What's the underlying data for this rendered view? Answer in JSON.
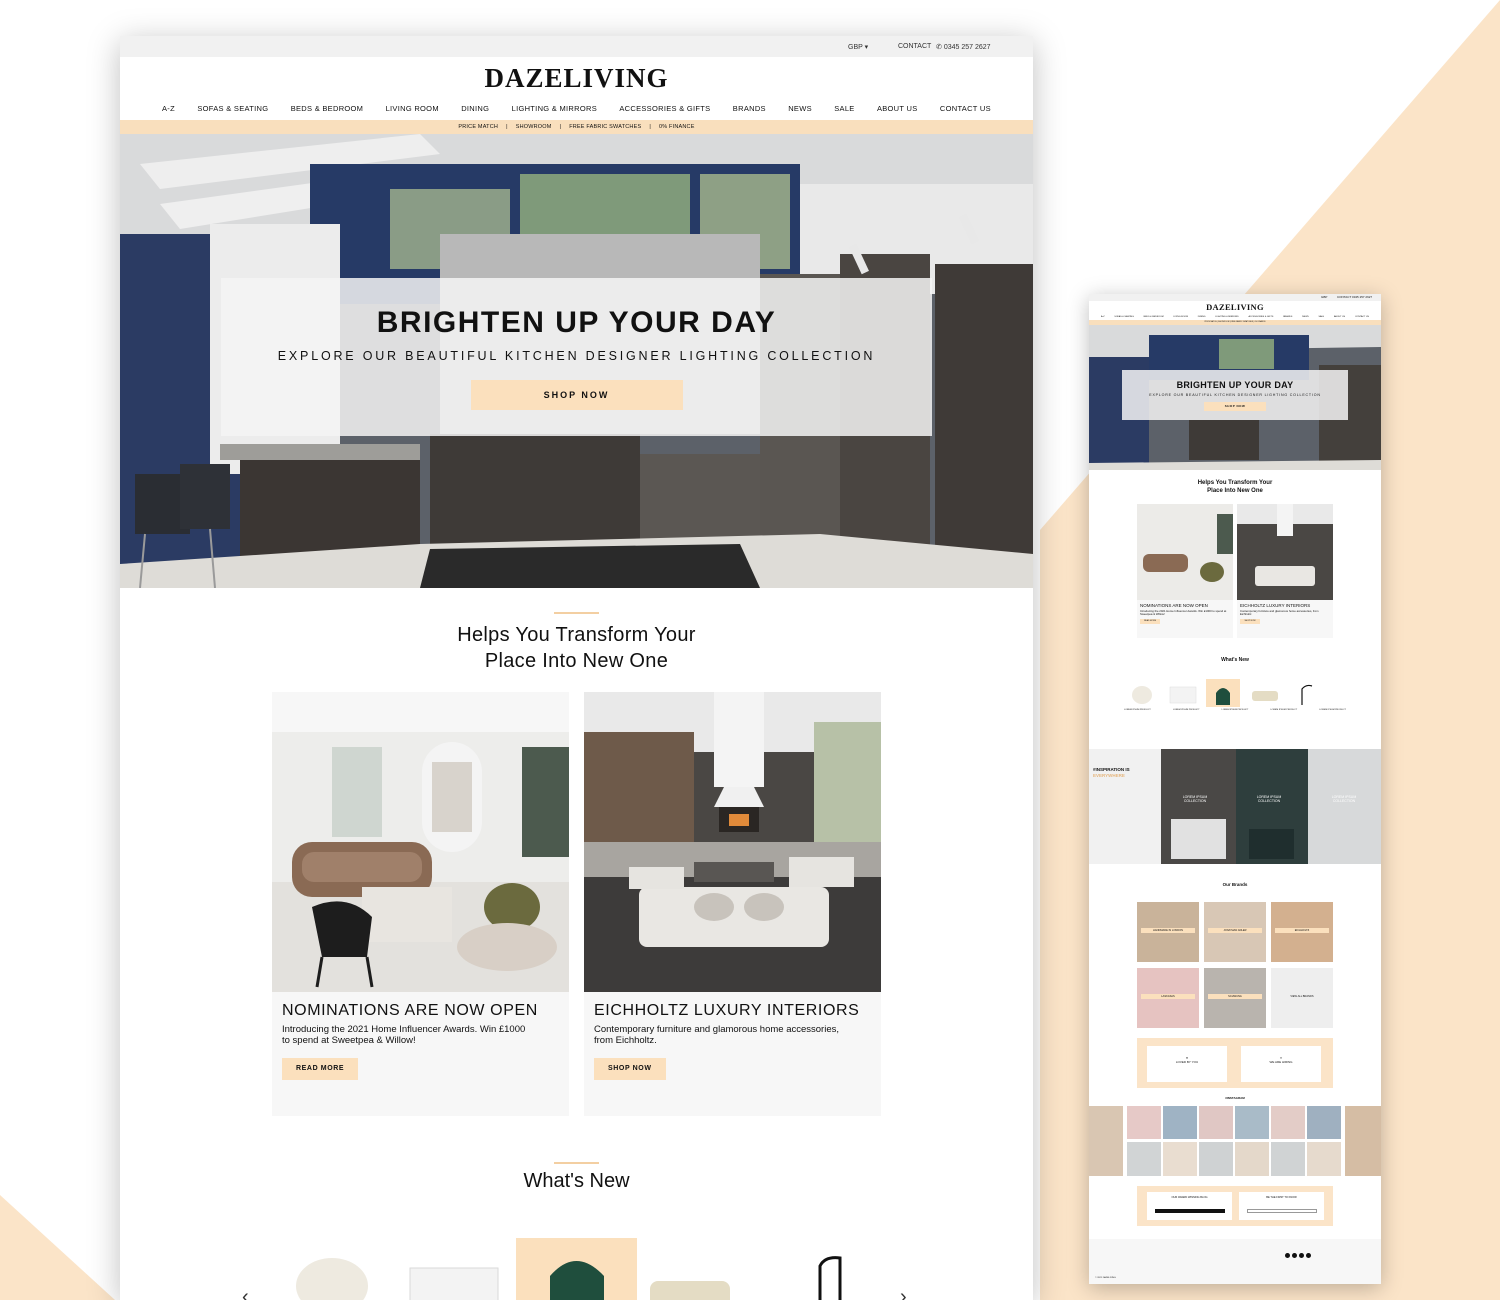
{
  "colors": {
    "peach": "#f9dfbd",
    "peach_bg": "#fbe4c8",
    "accent_rule": "#f3cfa2",
    "navy": "#2c3a5b",
    "light_gray": "#f1f1f1"
  },
  "desktop": {
    "topbar": {
      "currency": "GBP ▾",
      "contact": "CONTACT",
      "phone": "0345 257 2627"
    },
    "logo": "DAZELIVING",
    "nav": [
      "A-Z",
      "SOFAS & SEATING",
      "BEDS & BEDROOM",
      "LIVING ROOM",
      "DINING",
      "LIGHTING & MIRRORS",
      "ACCESSORIES & GIFTS",
      "BRANDS",
      "NEWS",
      "SALE",
      "ABOUT US",
      "CONTACT US"
    ],
    "promo": [
      "PRICE MATCH",
      "|",
      "SHOWROOM",
      "|",
      "FREE FABRIC SWATCHES",
      "|",
      "0% FINANCE"
    ],
    "hero": {
      "title": "BRIGHTEN UP YOUR DAY",
      "subtitle": "EXPLORE OUR BEAUTIFUL KITCHEN DESIGNER LIGHTING COLLECTION",
      "button": "SHOP NOW"
    },
    "section_title_line1": "Helps You Transform Your",
    "section_title_line2": "Place Into New One",
    "cards": [
      {
        "title": "NOMINATIONS ARE NOW OPEN",
        "desc": "Introducing the 2021 Home Influencer Awards. Win £1000 to spend at Sweetpea & Willow!",
        "button": "READ MORE"
      },
      {
        "title": "EICHHOLTZ LUXURY INTERIORS",
        "desc": "Contemporary furniture and glamorous home accessories, from Eichholtz.",
        "button": "SHOP NOW"
      }
    ],
    "whats_new": "What's New",
    "carousel_prev": "‹",
    "carousel_next": "›"
  },
  "mobile": {
    "logo": "DAZELIVING",
    "topbar": {
      "currency": "GBP",
      "contact": "CONTACT 0345 257 2627"
    },
    "nav": [
      "A-Z",
      "SOFAS & SEATING",
      "BEDS & BEDROOM",
      "LIVING ROOM",
      "DINING",
      "LIGHTING & MIRRORS",
      "ACCESSORIES & GIFTS",
      "BRANDS",
      "NEWS",
      "SALE",
      "ABOUT US",
      "CONTACT US"
    ],
    "promo": "PRICE MATCH | SHOWROOM | FREE FABRIC SWATCHES | 0% FINANCE",
    "hero": {
      "title": "BRIGHTEN UP YOUR DAY",
      "subtitle": "EXPLORE OUR BEAUTIFUL KITCHEN DESIGNER LIGHTING COLLECTION",
      "button": "SHOP NOW"
    },
    "section_title_line1": "Helps You Transform Your",
    "section_title_line2": "Place Into New One",
    "cards": [
      {
        "title": "NOMINATIONS ARE NOW OPEN",
        "desc": "Introducing the 2021 Home Influencer Awards. Win £1000 to spend at Sweetpea & Willow!",
        "button": "READ MORE"
      },
      {
        "title": "EICHHOLTZ LUXURY INTERIORS",
        "desc": "Contemporary furniture and glamorous home accessories, from Eichholtz.",
        "button": "SHOP NOW"
      }
    ],
    "whats_new": "What's New",
    "products": [
      "LOREM IPSUM PRODUCT",
      "LOREM IPSUM PRODUCT",
      "LOREM IPSUM PRODUCT",
      "LOREM IPSUM PRODUCT",
      "LOREM IPSUM PRODUCT"
    ],
    "inspiration_title_1": "#INSPIRATION IS",
    "inspiration_title_2": "EVERYWHERE",
    "inspiration_tiles": [
      "LOREM IPSUM COLLECTION",
      "LOREM IPSUM COLLECTION",
      "LOREM IPSUM COLLECTION"
    ],
    "our_brands": "Our Brands",
    "brands": [
      "HANDMADE IN LONDON",
      "JONATHAN ADLER",
      "EICHHOLTZ",
      "LASKASAS",
      "SCHWUNG",
      "VIEW ALL BRANDS"
    ],
    "loved_by_you": "LOVED BY YOU",
    "we_are_hiring": "WE ARE HIRING",
    "instagram": "#INSTAGRAM",
    "blog": "OUR AWARD WINNING BLOG",
    "first_to_know": "BE THE FIRST TO KNOW",
    "footer": "© 2021 DAZELIVING"
  }
}
